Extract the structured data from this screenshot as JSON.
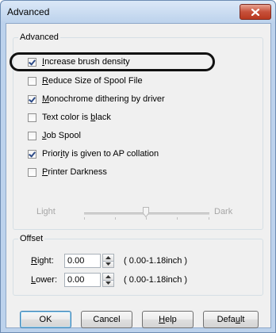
{
  "window": {
    "title": "Advanced"
  },
  "groups": {
    "advanced": {
      "label": "Advanced",
      "options": [
        {
          "id": "increase-brush-density",
          "label": "Increase brush density",
          "checked": true
        },
        {
          "id": "reduce-spool-size",
          "label": "Reduce Size of Spool File",
          "checked": false
        },
        {
          "id": "monochrome-dithering",
          "label": "Monochrome dithering by driver",
          "checked": true
        },
        {
          "id": "text-color-black",
          "label": "Text color is black",
          "checked": false
        },
        {
          "id": "job-spool",
          "label": "Job Spool",
          "checked": false
        },
        {
          "id": "priority-ap-collation",
          "label": "Priority is given to AP collation",
          "checked": true
        },
        {
          "id": "printer-darkness",
          "label": "Printer Darkness",
          "checked": false
        }
      ],
      "darkness": {
        "low_label": "Light",
        "high_label": "Dark",
        "level": 0.55
      }
    },
    "offset": {
      "label": "Offset",
      "right": {
        "label": "Right:",
        "value": "0.00",
        "range": "( 0.00-1.18inch )"
      },
      "lower": {
        "label": "Lower:",
        "value": "0.00",
        "range": "( 0.00-1.18inch )"
      }
    }
  },
  "buttons": {
    "ok": "OK",
    "cancel": "Cancel",
    "help": "Help",
    "default": "Default"
  },
  "icons": {
    "close": "close-icon",
    "spin_up": "spin-up-icon",
    "spin_down": "spin-down-icon"
  }
}
